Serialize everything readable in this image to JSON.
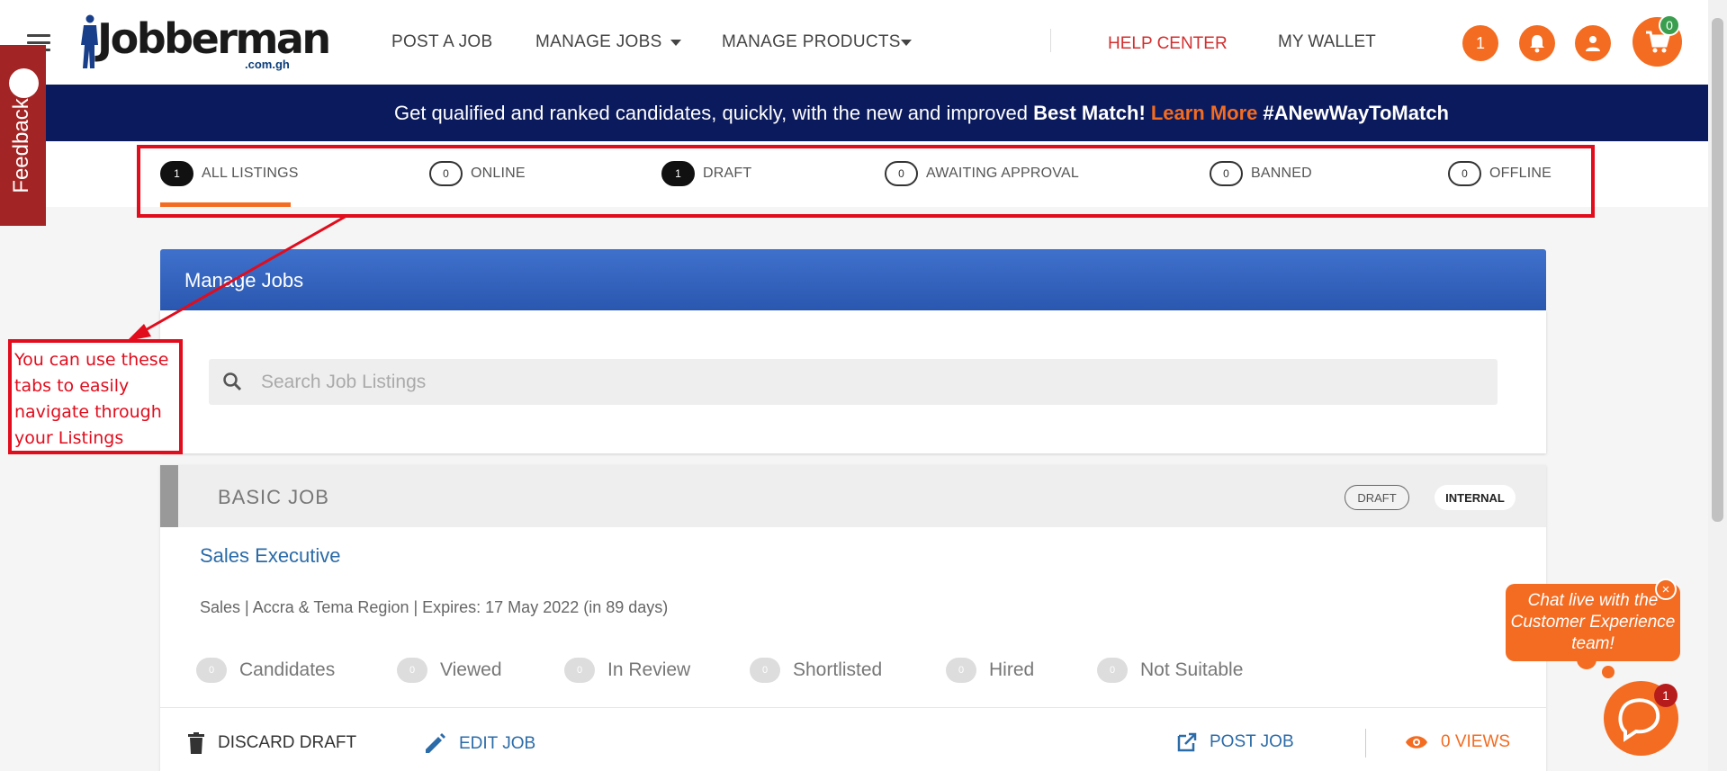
{
  "header": {
    "logo_text": "Jobberman",
    "logo_suffix": ".com.gh",
    "nav": {
      "post_job": "POST A JOB",
      "manage_jobs": "MANAGE JOBS",
      "manage_products": "MANAGE PRODUCTS",
      "help_center": "HELP CENTER",
      "my_wallet": "MY WALLET"
    },
    "notification_count": "1",
    "cart_count": "0"
  },
  "banner": {
    "text": "Get qualified and ranked candidates, quickly, with the new and improved",
    "highlight": "Best Match!",
    "link": "Learn More",
    "hashtag": "#ANewWayToMatch"
  },
  "tabs": [
    {
      "count": "1",
      "label": "ALL LISTINGS"
    },
    {
      "count": "0",
      "label": "ONLINE"
    },
    {
      "count": "1",
      "label": "DRAFT"
    },
    {
      "count": "0",
      "label": "AWAITING APPROVAL"
    },
    {
      "count": "0",
      "label": "BANNED"
    },
    {
      "count": "0",
      "label": "OFFLINE"
    }
  ],
  "feedback_label": "Feedback",
  "manage_jobs": {
    "title": "Manage Jobs",
    "search_placeholder": "Search Job Listings"
  },
  "listing": {
    "type": "BASIC JOB",
    "status_badge": "DRAFT",
    "visibility_badge": "INTERNAL",
    "title": "Sales Executive",
    "meta": "Sales | Accra & Tema Region | Expires: 17 May 2022 (in 89 days)",
    "stats": [
      {
        "count": "0",
        "label": "Candidates"
      },
      {
        "count": "0",
        "label": "Viewed"
      },
      {
        "count": "0",
        "label": "In Review"
      },
      {
        "count": "0",
        "label": "Shortlisted"
      },
      {
        "count": "0",
        "label": "Hired"
      },
      {
        "count": "0",
        "label": "Not Suitable"
      }
    ],
    "actions": {
      "discard": "DISCARD DRAFT",
      "edit": "EDIT JOB",
      "post": "POST JOB",
      "views": "0 VIEWS"
    }
  },
  "annotation": "You can use these tabs to easily navigate through your Listings",
  "chat": {
    "message": "Chat live with the Customer Experience team!",
    "close": "×",
    "badge": "1"
  },
  "colors": {
    "brand_orange": "#f36c21",
    "banner_navy": "#0b1a5c",
    "header_blue": "#2a57b0",
    "annotation_red": "#e10c1c"
  }
}
